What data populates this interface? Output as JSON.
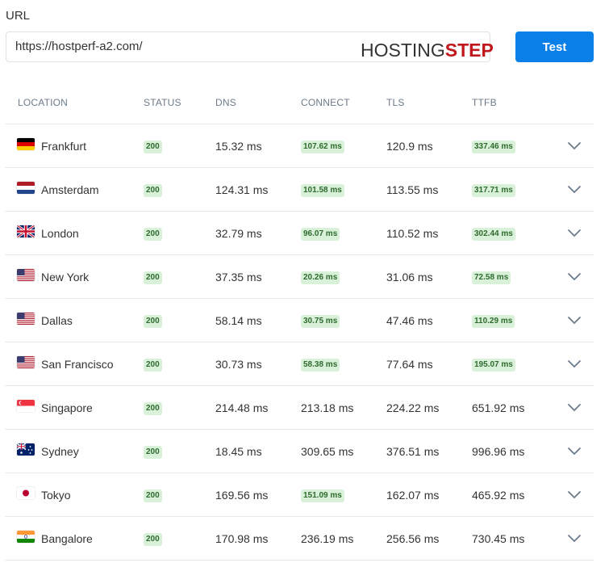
{
  "form": {
    "url_label": "URL",
    "url_value": "https://hostperf-a2.com/",
    "logo_part1": "HOSTING",
    "logo_part2": "STEP",
    "test_button": "Test"
  },
  "table": {
    "headers": [
      "LOCATION",
      "STATUS",
      "DNS",
      "CONNECT",
      "TLS",
      "TTFB"
    ],
    "rows": [
      {
        "location": "Frankfurt",
        "flag": "de",
        "status": "200",
        "dns": "15.32 ms",
        "connect": "107.62 ms",
        "connect_badge": true,
        "tls": "120.9 ms",
        "ttfb": "337.46 ms",
        "ttfb_badge": true
      },
      {
        "location": "Amsterdam",
        "flag": "nl",
        "status": "200",
        "dns": "124.31 ms",
        "connect": "101.58 ms",
        "connect_badge": true,
        "tls": "113.55 ms",
        "ttfb": "317.71 ms",
        "ttfb_badge": true
      },
      {
        "location": "London",
        "flag": "gb",
        "status": "200",
        "dns": "32.79 ms",
        "connect": "96.07 ms",
        "connect_badge": true,
        "tls": "110.52 ms",
        "ttfb": "302.44 ms",
        "ttfb_badge": true
      },
      {
        "location": "New York",
        "flag": "us",
        "status": "200",
        "dns": "37.35 ms",
        "connect": "20.26 ms",
        "connect_badge": true,
        "tls": "31.06 ms",
        "ttfb": "72.58 ms",
        "ttfb_badge": true
      },
      {
        "location": "Dallas",
        "flag": "us",
        "status": "200",
        "dns": "58.14 ms",
        "connect": "30.75 ms",
        "connect_badge": true,
        "tls": "47.46 ms",
        "ttfb": "110.29 ms",
        "ttfb_badge": true
      },
      {
        "location": "San Francisco",
        "flag": "us",
        "status": "200",
        "dns": "30.73 ms",
        "connect": "58.38 ms",
        "connect_badge": true,
        "tls": "77.64 ms",
        "ttfb": "195.07 ms",
        "ttfb_badge": true
      },
      {
        "location": "Singapore",
        "flag": "sg",
        "status": "200",
        "dns": "214.48 ms",
        "connect": "213.18 ms",
        "connect_badge": false,
        "tls": "224.22 ms",
        "ttfb": "651.92 ms",
        "ttfb_badge": false
      },
      {
        "location": "Sydney",
        "flag": "au",
        "status": "200",
        "dns": "18.45 ms",
        "connect": "309.65 ms",
        "connect_badge": false,
        "tls": "376.51 ms",
        "ttfb": "996.96 ms",
        "ttfb_badge": false
      },
      {
        "location": "Tokyo",
        "flag": "jp",
        "status": "200",
        "dns": "169.56 ms",
        "connect": "151.09 ms",
        "connect_badge": true,
        "tls": "162.07 ms",
        "ttfb": "465.92 ms",
        "ttfb_badge": false
      },
      {
        "location": "Bangalore",
        "flag": "in",
        "status": "200",
        "dns": "170.98 ms",
        "connect": "236.19 ms",
        "connect_badge": false,
        "tls": "256.56 ms",
        "ttfb": "730.45 ms",
        "ttfb_badge": false
      }
    ]
  },
  "icons": {
    "expand": "chevron-down-icon"
  },
  "colors": {
    "accent": "#0a7fe8",
    "badge_bg": "#d9f0d9",
    "badge_text": "#2f6b2f",
    "logo_red": "#c0171d"
  }
}
